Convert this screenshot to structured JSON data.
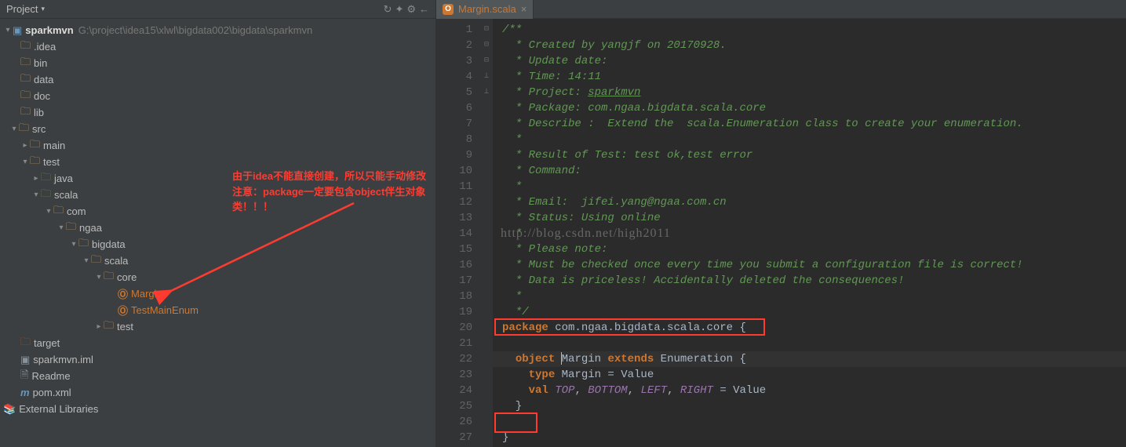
{
  "panel": {
    "title": "Project",
    "tools": [
      "↻",
      "✦",
      "⚙",
      "←"
    ]
  },
  "root": {
    "name": "sparkmvn",
    "path": "G:\\project\\idea15\\xlwl\\bigdata002\\bigdata\\sparkmvn"
  },
  "tree": {
    "idea": ".idea",
    "bin": "bin",
    "data": "data",
    "doc": "doc",
    "lib": "lib",
    "src": "src",
    "main": "main",
    "test": "test",
    "java": "java",
    "scala": "scala",
    "com": "com",
    "ngaa": "ngaa",
    "bigdata": "bigdata",
    "scala2": "scala",
    "core": "core",
    "margin": "Margin",
    "testmainenum": "TestMainEnum",
    "test2": "test",
    "target": "target",
    "sparkmvniml": "sparkmvn.iml",
    "readme": "Readme",
    "pomxml": "pom.xml",
    "external": "External Libraries"
  },
  "annotation": {
    "line1": "由于idea不能直接创建，所以只能手动修改",
    "line2": "注意：package一定要包含object伴生对象类！！！"
  },
  "tab": {
    "name": "Margin.scala"
  },
  "watermark": "http://blog.csdn.net/high2011",
  "code": {
    "l1": "/**",
    "l2": "  * Created by yangjf on 20170928.",
    "l3": "  * Update date:",
    "l4": "  * Time: 14:11",
    "l5_a": "  * Project: ",
    "l5_b": "sparkmvn",
    "l6": "  * Package: com.ngaa.bigdata.scala.core",
    "l7": "  * Describe :  Extend the  scala.Enumeration class to create your enumeration.",
    "l8": "  *",
    "l9": "  * Result of Test: test ok,test error",
    "l10": "  * Command:",
    "l11": "  *",
    "l12": "  * Email:  jifei.yang@ngaa.com.cn",
    "l13": "  * Status: Using online",
    "l14": "  *",
    "l15": "  * Please note:",
    "l16": "  * Must be checked once every time you submit a configuration file is correct!",
    "l17": "  * Data is priceless! Accidentally deleted the consequences!",
    "l18": "  *",
    "l19": "  */",
    "l20_kw": "package",
    "l20_rest": " com.ngaa.bigdata.scala.core {",
    "l22_kw": "object",
    "l22_name": " Margin ",
    "l22_ext": "extends",
    "l22_rest": " Enumeration {",
    "l23_kw": "type",
    "l23_rest": " Margin = Value",
    "l24_kw": "val",
    "l24_top": " TOP",
    "l24_c1": ", ",
    "l24_bottom": "BOTTOM",
    "l24_c2": ", ",
    "l24_left": "LEFT",
    "l24_c3": ", ",
    "l24_right": "RIGHT",
    "l24_rest": " = Value",
    "l25": "  }",
    "l27": "}"
  }
}
